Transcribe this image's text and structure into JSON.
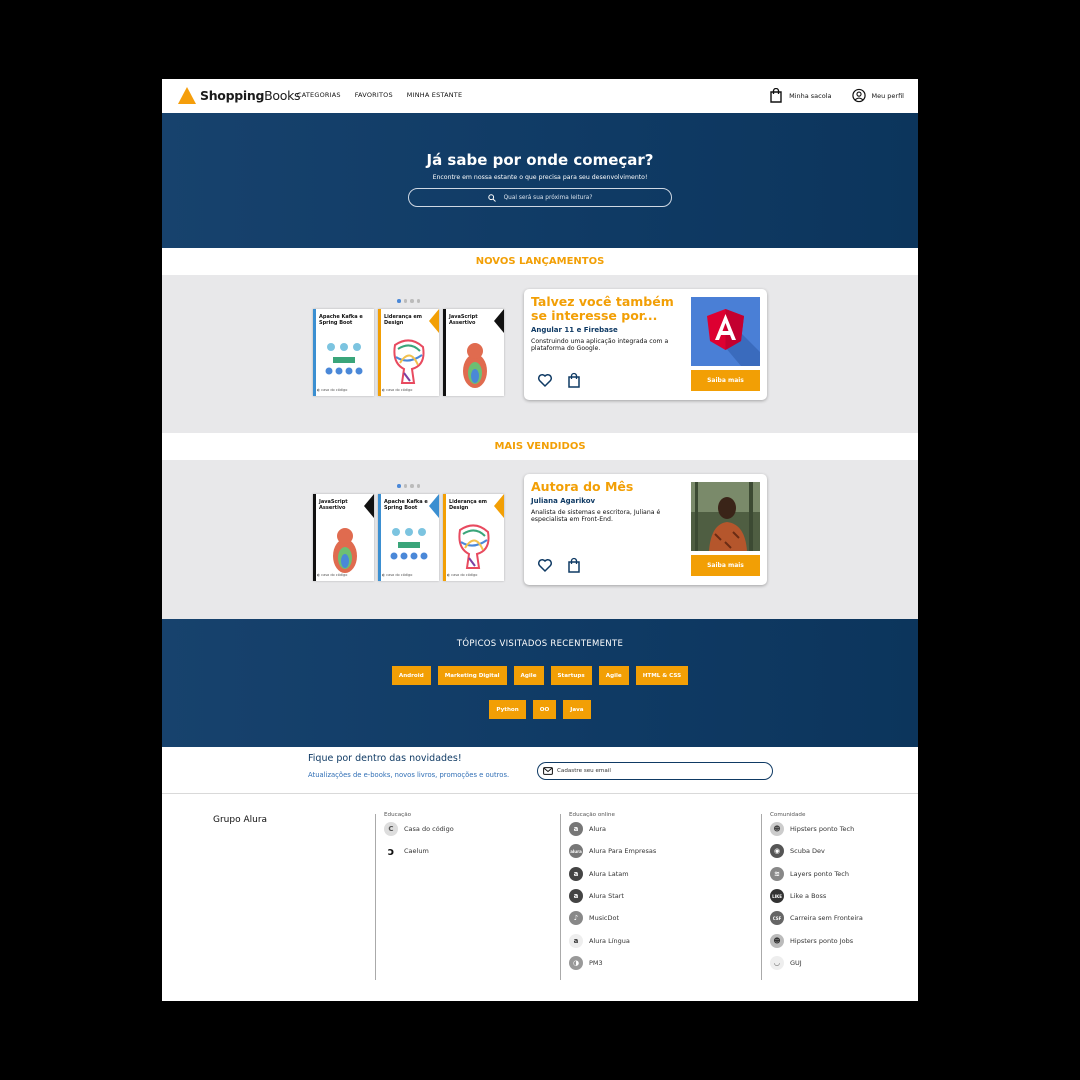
{
  "header": {
    "logo_strong": "Shopping",
    "logo_light": "Books",
    "nav": [
      "CATEGORIAS",
      "FAVORITOS",
      "MINHA ESTANTE"
    ],
    "bag_label": "Minha sacola",
    "profile_label": "Meu perfil"
  },
  "hero": {
    "title": "Já sabe por onde começar?",
    "subtitle": "Encontre em nossa estante o que precisa para seu desenvolvimento!",
    "search_placeholder": "Qual será sua próxima leitura?"
  },
  "new_releases": {
    "title": "NOVOS LANÇAMENTOS",
    "books": [
      {
        "title": "Apache Kafka e Spring Boot",
        "edge": "#3b8fd1"
      },
      {
        "title": "Liderança em Design",
        "edge": "#f29f05"
      },
      {
        "title": "JavaScript Assertivo",
        "edge": "#111111"
      }
    ],
    "card": {
      "heading": "Talvez você também se interesse por...",
      "book_title": "Angular 11 e Firebase",
      "description": "Construindo uma aplicação integrada com a plataforma do Google.",
      "button": "Saiba mais",
      "image_icon": "angular-logo"
    }
  },
  "best_sellers": {
    "title": "MAIS VENDIDOS",
    "books": [
      {
        "title": "JavaScript Assertivo",
        "edge": "#111111"
      },
      {
        "title": "Apache Kafka e Spring Boot",
        "edge": "#3b8fd1"
      },
      {
        "title": "Liderança em Design",
        "edge": "#f29f05"
      }
    ],
    "card": {
      "heading": "Autora do Mês",
      "author": "Juliana Agarikov",
      "description": "Analista de sistemas e escritora, Juliana é especialista em Front-End.",
      "button": "Saiba mais",
      "image_icon": "author-photo"
    }
  },
  "topics": {
    "title": "TÓPICOS VISITADOS RECENTEMENTE",
    "row1": [
      "Android",
      "Marketing Digital",
      "Agile",
      "Startups",
      "Agile",
      "HTML & CSS"
    ],
    "row2": [
      "Python",
      "OO",
      "Java"
    ]
  },
  "newsletter": {
    "title": "Fique por dentro das novidades!",
    "text": "Atualizações de e-books, novos livros, promoções e outros.",
    "placeholder": "Cadastre seu email"
  },
  "footer": {
    "group": "Grupo Alura",
    "columns": [
      {
        "heading": "Educação",
        "items": [
          "Casa do código",
          "Caelum"
        ]
      },
      {
        "heading": "Educação online",
        "items": [
          "Alura",
          "Alura Para Empresas",
          "Alura Latam",
          "Alura Start",
          "MusicDot",
          "Alura Língua",
          "PM3"
        ]
      },
      {
        "heading": "Comunidade",
        "items": [
          "Hipsters ponto Tech",
          "Scuba Dev",
          "Layers ponto Tech",
          "Like a Boss",
          "Carreira sem Fronteira",
          "Hipsters ponto Jobs",
          "GUJ"
        ]
      }
    ]
  },
  "colors": {
    "accent": "#f29f05",
    "navy": "#0f3a64",
    "band": "#e8e8ea"
  }
}
